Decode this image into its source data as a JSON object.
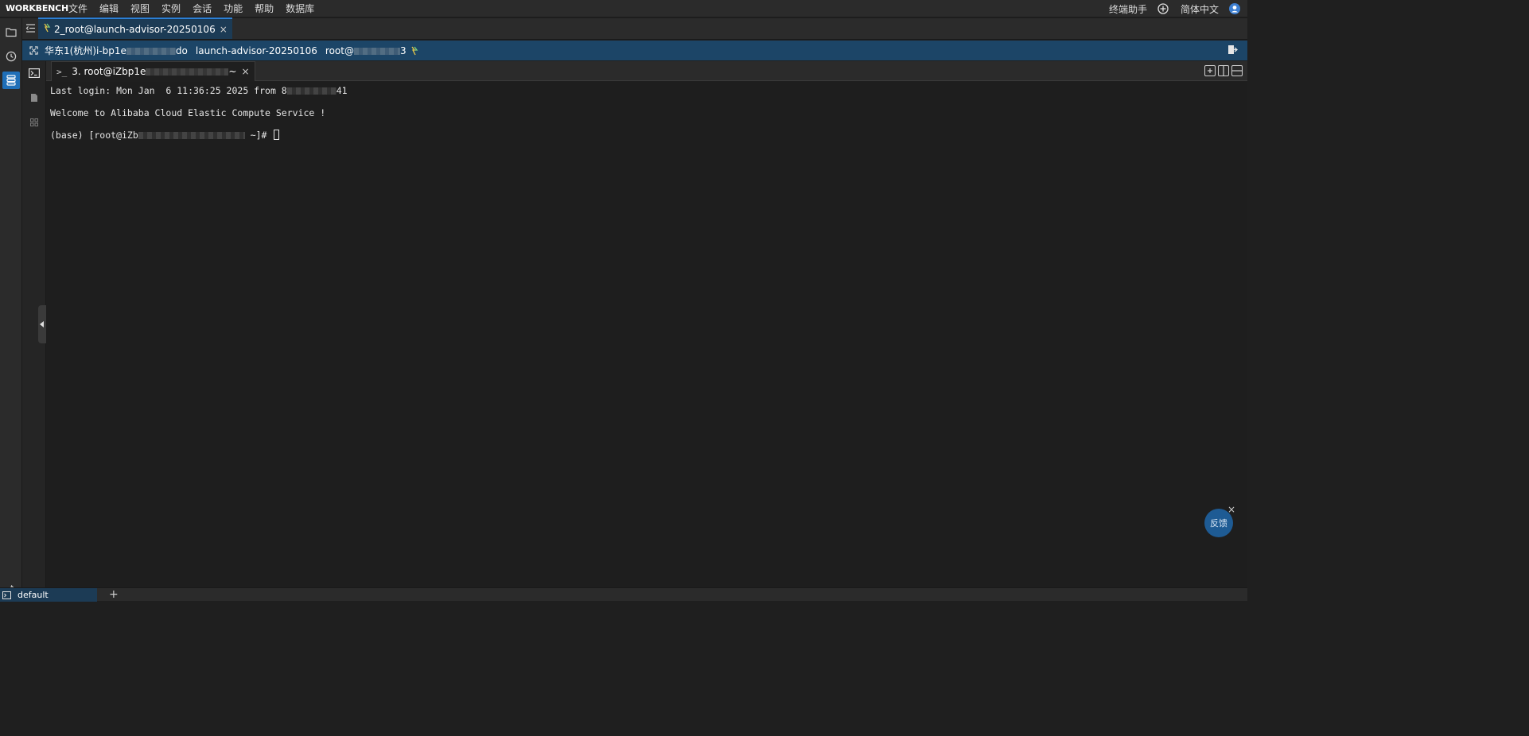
{
  "app": {
    "brand": "WORKBENCH",
    "menu": [
      "文件",
      "编辑",
      "视图",
      "实例",
      "会话",
      "功能",
      "帮助",
      "数据库"
    ],
    "right": {
      "assistant_label": "终端助手",
      "language_label": "简体中文",
      "add_icon": "plus-circle-icon",
      "user_icon": "user-avatar-icon"
    }
  },
  "session_tab": {
    "label": "2_root@launch-advisor-20250106",
    "icon": "connection-status-icon",
    "close": "×"
  },
  "infobar": {
    "region_prefix": "华东1(杭州)i-bp1e",
    "region_suffix": "do",
    "instance_name": "launch-advisor-20250106",
    "user_prefix": "root@",
    "user_suffix": "3"
  },
  "terminal_tab": {
    "prompt_glyph": ">_",
    "label_prefix": "3. root@iZbp1e",
    "label_suffix": "~",
    "close": "×"
  },
  "terminal": {
    "line1_prefix": "Last login: Mon Jan  6 11:36:25 2025 from 8",
    "line1_suffix": "41",
    "line2": "Welcome to Alibaba Cloud Elastic Compute Service !",
    "line3_prefix": "(base) [root@iZb",
    "line3_suffix": " ~]# "
  },
  "feedback": {
    "label": "反馈",
    "close": "×"
  },
  "bottom": {
    "tab_label": "default",
    "add": "+"
  },
  "colors": {
    "accent": "#2d7fd4",
    "infobar": "#1c4567",
    "terminal_bg": "#1e1e1e",
    "feedback": "#1e5b94"
  }
}
